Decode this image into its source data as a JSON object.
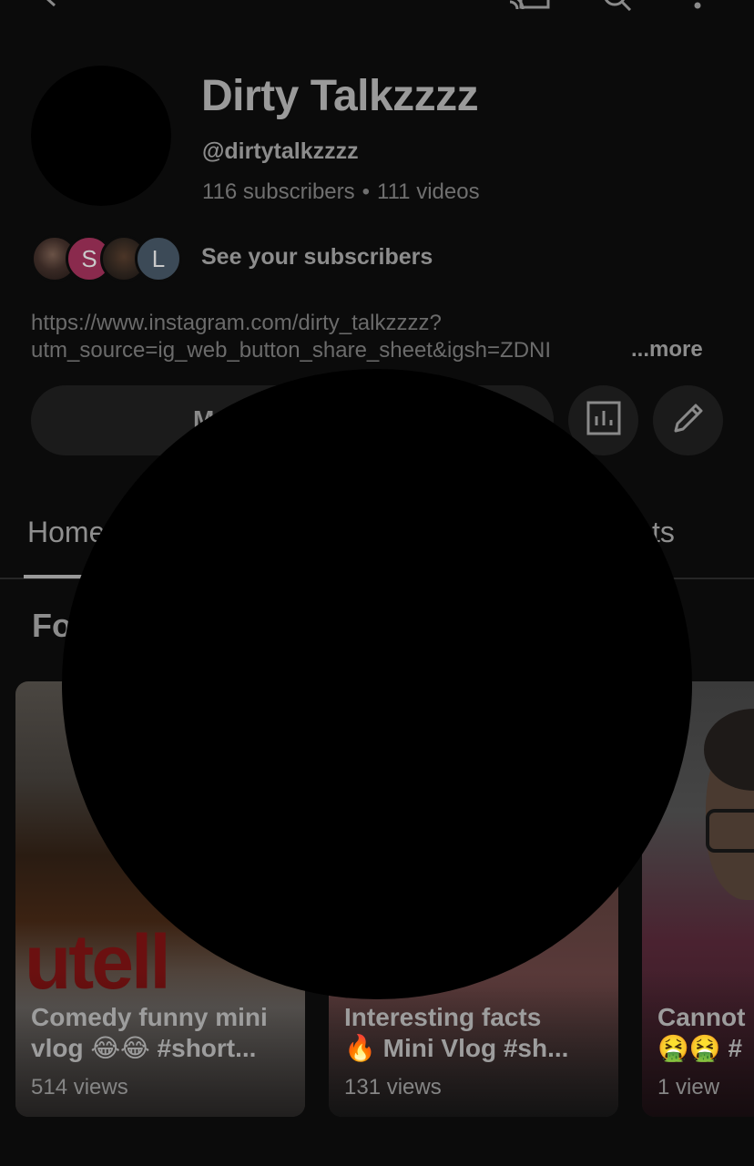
{
  "channel": {
    "name": "Dirty Talkzzzz",
    "handle": "@dirtytalkzzzz",
    "subscribers": "116 subscribers",
    "separator": "•",
    "videos": "111 videos",
    "see_subscribers": "See your subscribers",
    "subscriber_avatars": [
      {
        "letter": ""
      },
      {
        "letter": "S"
      },
      {
        "letter": ""
      },
      {
        "letter": "L"
      }
    ],
    "description_line1": "https://www.instagram.com/dirty_talkzzzz?",
    "description_line2": "utm_source=ig_web_button_share_sheet&igsh=ZDNI",
    "more": "...more",
    "manage_label": "M"
  },
  "tabs": {
    "home": "Home",
    "posts": "sts"
  },
  "section": {
    "title": "Fo"
  },
  "shorts": [
    {
      "title_line1": "Comedy funny mini",
      "title_line2": "vlog 😂😂 #short...",
      "views": "514 views",
      "thumb_text": "utell"
    },
    {
      "title_line1": "Interesting facts",
      "title_line2": "🔥 Mini Vlog #sh...",
      "views": "131 views"
    },
    {
      "title_line1": "Cannot",
      "title_line2": "🤮🤮 #",
      "views": "1 view"
    }
  ],
  "icons": [
    "back-icon",
    "cast-icon",
    "search-icon",
    "more-vert-icon",
    "analytics-icon",
    "edit-pencil-icon"
  ]
}
